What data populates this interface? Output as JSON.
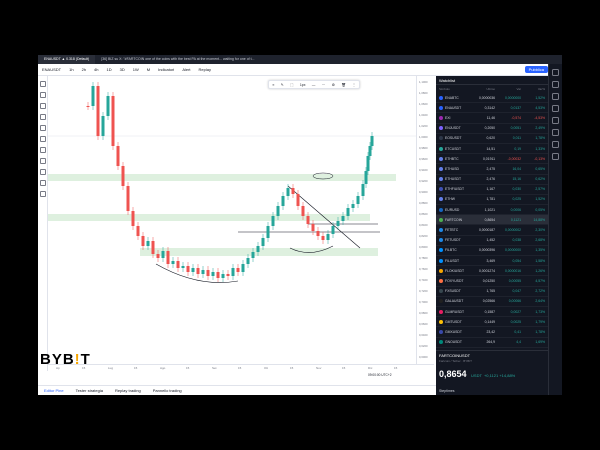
{
  "browser": {
    "tabs": [
      "ENAUSDT ▲ 0.318 (Default)",
      "[36] BIZ su X: \"#FARTCOIN one of the coins with the best PA at the moment... waiting for one of t..."
    ]
  },
  "toolbar": {
    "symbol": "ENAUSDT",
    "timeframes": [
      "1h",
      "2h",
      "4h",
      "1D",
      "3D",
      "1W",
      "M"
    ],
    "indicators_label": "Indicatori",
    "alert_label": "Alert",
    "replay_label": "Replay",
    "publish_label": "Pubblica"
  },
  "drawing_toolbar": {
    "items": [
      "≡",
      "✎",
      "⬚",
      "1px",
      "—",
      "⋯",
      "⚙",
      "🗑",
      "⋮"
    ]
  },
  "price_axis": {
    "labels": [
      "1,1000",
      "1,0800",
      "1,0600",
      "1,0400",
      "1,0200",
      "1,0000",
      "0,9800",
      "0,9600",
      "0,9400",
      "0,9200",
      "0,9000",
      "0,8800",
      "0,8600",
      "0,8400",
      "0,8200",
      "0,8000",
      "0,7800",
      "0,7600",
      "0,7400",
      "0,7200",
      "0,7000",
      "0,6800",
      "0,6600",
      "0,6400",
      "0,6200",
      "0,6000"
    ]
  },
  "time_axis": {
    "labels": [
      "Ap",
      "15",
      "Lug",
      "15",
      "Ago",
      "15",
      "Set",
      "15",
      "Ott",
      "15",
      "Nov",
      "15",
      "Dic",
      "15"
    ]
  },
  "status": {
    "time": "09:00:00 UTC+2"
  },
  "bottom_tabs": [
    "Editor Pine",
    "Tester strategia",
    "Replay trading",
    "Pannello trading"
  ],
  "logo": {
    "text_a": "BYB",
    "text_b": "T"
  },
  "watchlist": {
    "title": "Watchlist",
    "columns": [
      "Simbolo",
      "Ultimo",
      "Var",
      "Var%"
    ],
    "rows": [
      {
        "sym": "ENABTC",
        "last": "0,0000036",
        "chg": "0,0000000",
        "pct": "1,52%",
        "color": "#2962ff",
        "dir": "pos"
      },
      {
        "sym": "ENAUSDT",
        "last": "0,3142",
        "chg": "0,0137",
        "pct": "4,53%",
        "color": "#2962ff",
        "dir": "pos"
      },
      {
        "sym": "EXI",
        "last": "11,46",
        "chg": "-0,574",
        "pct": "-4,53%",
        "color": "#9c27b0",
        "dir": "neg"
      },
      {
        "sym": "ENJUSDT",
        "last": "0,2050",
        "chg": "0,0051",
        "pct": "2,49%",
        "color": "#7b61ff",
        "dir": "pos"
      },
      {
        "sym": "EOSUSDT",
        "last": "0,620",
        "chg": "0,011",
        "pct": "1,78%",
        "color": "#2d3748",
        "dir": "pos"
      },
      {
        "sym": "ETCUSDT",
        "last": "14,51",
        "chg": "0,19",
        "pct": "1,33%",
        "color": "#26a69a",
        "dir": "pos"
      },
      {
        "sym": "ETHBTC",
        "last": "0,01911",
        "chg": "-0,00032",
        "pct": "-0,13%",
        "color": "#627eea",
        "dir": "neg"
      },
      {
        "sym": "ETHUSD",
        "last": "2,475",
        "chg": "16,04",
        "pct": "0,65%",
        "color": "#627eea",
        "dir": "pos"
      },
      {
        "sym": "ETHUSDT",
        "last": "2,476",
        "chg": "15,16",
        "pct": "0,62%",
        "color": "#627eea",
        "dir": "pos"
      },
      {
        "sym": "ETHFIUSDT",
        "last": "1,167",
        "chg": "0,030",
        "pct": "2,57%",
        "color": "#3f51b5",
        "dir": "pos"
      },
      {
        "sym": "ETHW",
        "last": "1,781",
        "chg": "0,025",
        "pct": "1,52%",
        "color": "#627eea",
        "dir": "pos"
      },
      {
        "sym": "EURUSD",
        "last": "1,1021",
        "chg": "0,0006",
        "pct": "0,05%",
        "color": "#1565c0",
        "dir": "pos"
      },
      {
        "sym": "FARTCOIN",
        "last": "0,8654",
        "chg": "0,1121",
        "pct": "14,88%",
        "color": "#4caf50",
        "dir": "pos"
      },
      {
        "sym": "FETBTC",
        "last": "0,0000187",
        "chg": "0,0000002",
        "pct": "2,30%",
        "color": "#1e88e5",
        "dir": "pos"
      },
      {
        "sym": "FETUSDT",
        "last": "1,452",
        "chg": "0,038",
        "pct": "2,68%",
        "color": "#1e88e5",
        "dir": "pos"
      },
      {
        "sym": "FILBTC",
        "last": "0,0000396",
        "chg": "0,0000000",
        "pct": "1,35%",
        "color": "#0090ff",
        "dir": "pos"
      },
      {
        "sym": "FILUSDT",
        "last": "3,469",
        "chg": "0,054",
        "pct": "1,58%",
        "color": "#0090ff",
        "dir": "pos"
      },
      {
        "sym": "FLOKIUSDT",
        "last": "0,0001274",
        "chg": "0,0000016",
        "pct": "1,26%",
        "color": "#f7a600",
        "dir": "pos"
      },
      {
        "sym": "FOXYUSDT",
        "last": "0,01250",
        "chg": "0,00055",
        "pct": "4,57%",
        "color": "#ff7043",
        "dir": "pos"
      },
      {
        "sym": "FXSUSDT",
        "last": "1,765",
        "chg": "0,047",
        "pct": "2,72%",
        "color": "#37474f",
        "dir": "pos"
      },
      {
        "sym": "GALAUSDT",
        "last": "0,02566",
        "chg": "0,00066",
        "pct": "2,64%",
        "color": "#212121",
        "dir": "pos"
      },
      {
        "sym": "GLMRUSDT",
        "last": "0,1587",
        "chg": "0,0027",
        "pct": "1,73%",
        "color": "#e91e63",
        "dir": "pos"
      },
      {
        "sym": "GMTUSDT",
        "last": "0,1449",
        "chg": "0,0025",
        "pct": "1,79%",
        "color": "#ffc107",
        "dir": "pos"
      },
      {
        "sym": "GMXUSDT",
        "last": "23,42",
        "chg": "0,41",
        "pct": "1,78%",
        "color": "#3949ab",
        "dir": "pos"
      },
      {
        "sym": "GNOUSDT",
        "last": "264,9",
        "chg": "4,4",
        "pct": "1,69%",
        "color": "#00897b",
        "dir": "pos"
      },
      {
        "sym": "GOATUSDT",
        "last": "0,4391",
        "chg": "0,0161",
        "pct": "3,81%",
        "color": "#8d6e63",
        "dir": "pos"
      }
    ],
    "detail": {
      "symbol": "FARTCOINUSDT",
      "subtitle": "Fartcoin / Tether · BYBIT",
      "price": "0,8654",
      "currency": "USDT",
      "change": "+0,1121 +14,88%",
      "link": "Steptimes"
    }
  }
}
